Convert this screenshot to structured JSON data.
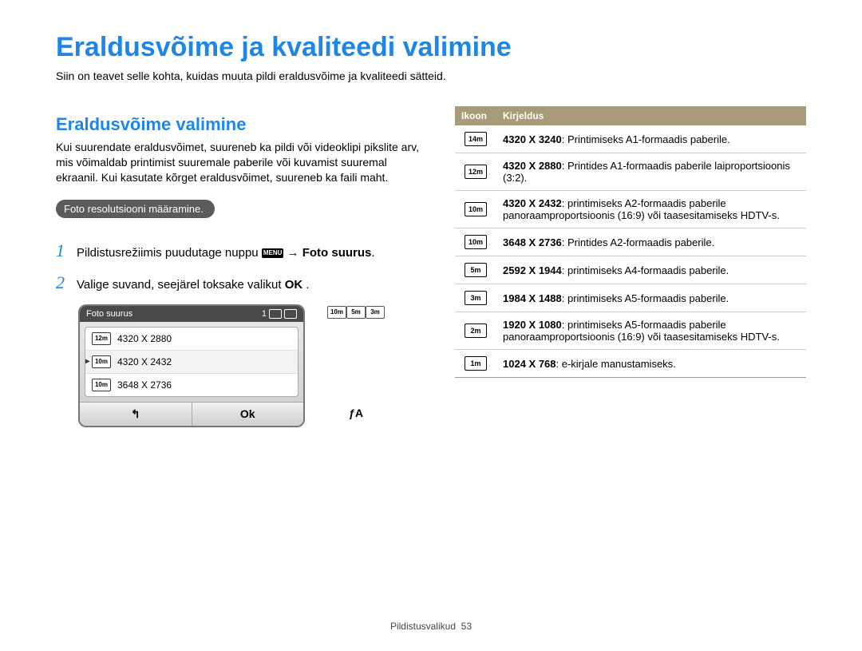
{
  "title": "Eraldusvõime ja kvaliteedi valimine",
  "intro": "Siin on teavet selle kohta, kuidas muuta pildi eraldusvõime ja kvaliteedi sätteid.",
  "section_title": "Eraldusvõime valimine",
  "body_text": "Kui suurendate eraldusvõimet, suureneb ka pildi või videoklipi pikslite arv, mis võimaldab printimist suuremale paberile või kuvamist suuremal ekraanil. Kui kasutate kõrget eraldusvõimet, suureneb ka faili maht.",
  "pill_label": "Foto resolutsiooni määramine.",
  "step1": {
    "num": "1",
    "pre": "Pildistusrežiimis puudutage nuppu ",
    "menu_badge": "MENU",
    "arrow": " → ",
    "bold": "Foto suurus",
    "suffix": "."
  },
  "step2": {
    "num": "2",
    "pre": "Valige suvand, seejärel toksake valikut ",
    "ok": "OK",
    "suffix": " ."
  },
  "cam": {
    "header_title": "Foto suurus",
    "header_count": "1",
    "rows": [
      {
        "icon": "12m",
        "label": "4320 X 2880"
      },
      {
        "icon": "10m",
        "label": "4320 X 2432"
      },
      {
        "icon": "10m",
        "label": "3648 X 2736"
      }
    ],
    "selected_index": 1,
    "back": "↰",
    "ok": "Ok"
  },
  "side_icons": [
    "10m",
    "5m",
    "3m"
  ],
  "flash_label": "ƒA",
  "table": {
    "head_icon": "Ikoon",
    "head_desc": "Kirjeldus",
    "rows": [
      {
        "icon": "14m",
        "bold": "4320 X 3240",
        "rest": ": Printimiseks A1-formaadis paberile."
      },
      {
        "icon": "12m",
        "bold": "4320 X 2880",
        "rest": ": Printides A1-formaadis paberile laiproportsioonis (3:2)."
      },
      {
        "icon": "10m",
        "bold": "4320 X 2432",
        "rest": ": printimiseks A2-formaadis paberile panoraamproportsioonis (16:9) või taasesitamiseks HDTV-s."
      },
      {
        "icon": "10m",
        "bold": "3648 X 2736",
        "rest": ": Printides A2-formaadis paberile."
      },
      {
        "icon": "5m",
        "bold": "2592 X 1944",
        "rest": ": printimiseks A4-formaadis paberile."
      },
      {
        "icon": "3m",
        "bold": "1984 X 1488",
        "rest": ": printimiseks A5-formaadis paberile."
      },
      {
        "icon": "2m",
        "bold": "1920 X 1080",
        "rest": ": printimiseks A5-formaadis paberile panoraamproportsioonis (16:9) või taasesitamiseks HDTV-s."
      },
      {
        "icon": "1m",
        "bold": "1024 X 768",
        "rest": ": e-kirjale manustamiseks."
      }
    ]
  },
  "footer": {
    "label": "Pildistusvalikud",
    "page": "53"
  }
}
